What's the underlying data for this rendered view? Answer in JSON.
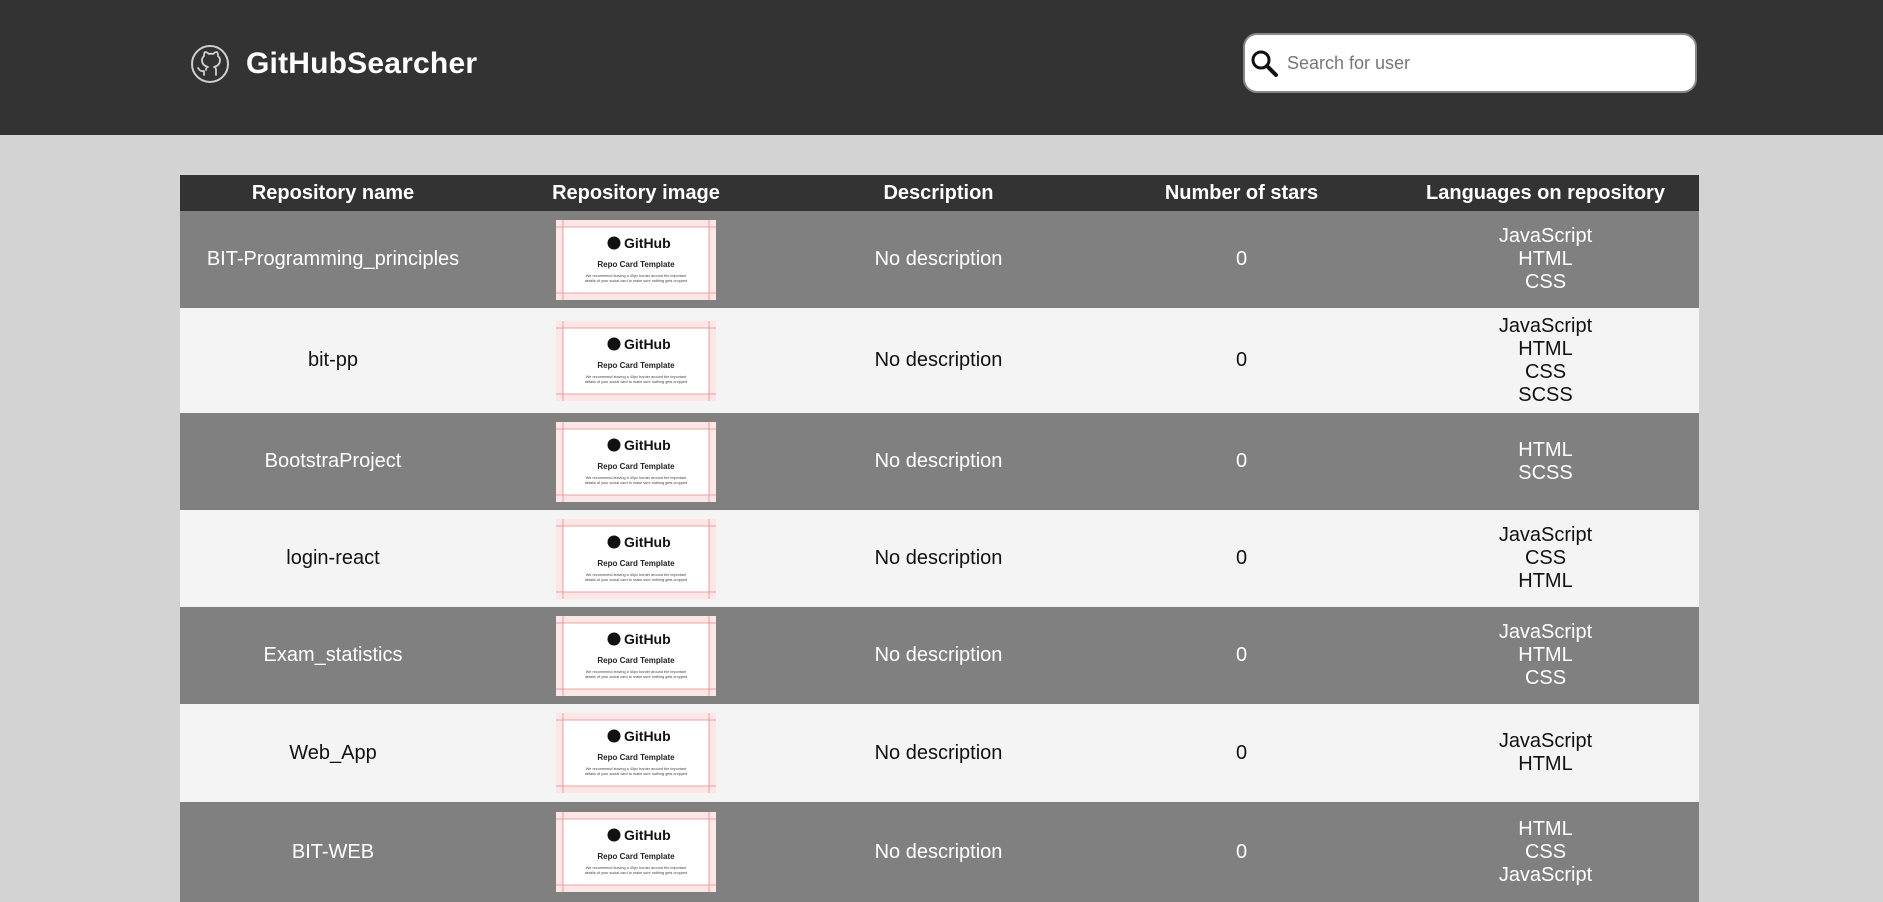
{
  "header": {
    "app_title": "GitHubSearcher",
    "logo_icon": "github-octocat-icon",
    "search": {
      "placeholder": "Search for user",
      "value": "",
      "icon": "search-icon"
    }
  },
  "table": {
    "columns": [
      "Repository name",
      "Repository image",
      "Description",
      "Number of stars",
      "Languages on repository"
    ],
    "thumbnail": {
      "brand": "GitHub",
      "title": "Repo Card Template",
      "note_line1": "We recommend leaving a 40px border around the important",
      "note_line2": "details of your social card to make sure nothing gets cropped"
    },
    "rows": [
      {
        "name": "BIT-Programming_principles",
        "description": "No description",
        "stars": "0",
        "languages": [
          "JavaScript",
          "HTML",
          "CSS"
        ]
      },
      {
        "name": "bit-pp",
        "description": "No description",
        "stars": "0",
        "languages": [
          "JavaScript",
          "HTML",
          "CSS",
          "SCSS"
        ]
      },
      {
        "name": "BootstraProject",
        "description": "No description",
        "stars": "0",
        "languages": [
          "HTML",
          "SCSS"
        ]
      },
      {
        "name": "login-react",
        "description": "No description",
        "stars": "0",
        "languages": [
          "JavaScript",
          "CSS",
          "HTML"
        ]
      },
      {
        "name": "Exam_statistics",
        "description": "No description",
        "stars": "0",
        "languages": [
          "JavaScript",
          "HTML",
          "CSS"
        ]
      },
      {
        "name": "Web_App",
        "description": "No description",
        "stars": "0",
        "languages": [
          "JavaScript",
          "HTML"
        ]
      },
      {
        "name": "BIT-WEB",
        "description": "No description",
        "stars": "0",
        "languages": [
          "HTML",
          "CSS",
          "JavaScript"
        ]
      }
    ]
  },
  "colors": {
    "header_bg": "#333333",
    "page_bg": "#d3d3d3",
    "row_dark": "#808080",
    "row_light": "#f4f4f4"
  }
}
